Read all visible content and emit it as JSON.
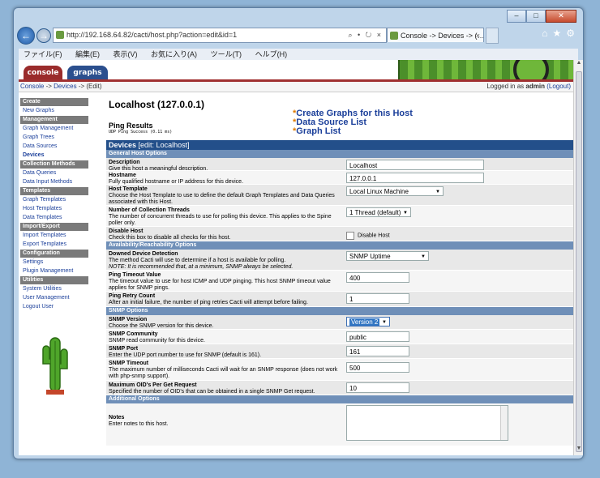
{
  "browser": {
    "address_url": "http://192.168.64.82/cacti/host.php?action=edit&id=1",
    "address_tools": "⌕ • ↻ ×",
    "tab_title": "Console -> Devices -> (…",
    "tab_close": "×",
    "caption": {
      "minimize": "–",
      "maximize": "□",
      "close": "✕"
    },
    "back": "←",
    "forward": "→",
    "right_icons": "⌂★⚙",
    "menu": [
      "ファイル(F)",
      "編集(E)",
      "表示(V)",
      "お気に入り(A)",
      "ツール(T)",
      "ヘルプ(H)"
    ]
  },
  "cacti": {
    "tabs": {
      "console": "console",
      "graphs": "graphs"
    },
    "breadcrumb": {
      "console": "Console",
      "sep": " -> ",
      "devices": "Devices",
      "sep2": " -> ",
      "current": "(Edit)"
    },
    "login": {
      "prefix": "Logged in as ",
      "user": "admin",
      "logout": "(Logout)"
    }
  },
  "sidebar": {
    "groups": [
      {
        "header": "Create",
        "items": [
          "New Graphs"
        ]
      },
      {
        "header": "Management",
        "items": [
          "Graph Management",
          "Graph Trees",
          "Data Sources",
          "Devices"
        ]
      },
      {
        "header": "Collection Methods",
        "items": [
          "Data Queries",
          "Data Input Methods"
        ]
      },
      {
        "header": "Templates",
        "items": [
          "Graph Templates",
          "Host Templates",
          "Data Templates"
        ]
      },
      {
        "header": "Import/Export",
        "items": [
          "Import Templates",
          "Export Templates"
        ]
      },
      {
        "header": "Configuration",
        "items": [
          "Settings",
          "Plugin Management"
        ]
      },
      {
        "header": "Utilities",
        "items": [
          "System Utilities",
          "User Management",
          "Logout User"
        ]
      }
    ],
    "active": "Devices"
  },
  "host": {
    "title": "Localhost (127.0.0.1)",
    "ping_title": "Ping Results",
    "ping_status": "UDP Ping Success (0.11 ms)",
    "links": [
      "Create Graphs for this Host",
      "Data Source List",
      "Graph List"
    ],
    "link_star": "*"
  },
  "form": {
    "header": "Devices",
    "header_edit": "[edit: Localhost]",
    "sections": {
      "general": "General Host Options",
      "availability": "Availability/Reachability Options",
      "snmp": "SNMP Options",
      "additional": "Additional Options"
    },
    "fields": {
      "description": {
        "label": "Description",
        "help": "Give this host a meaningful description.",
        "value": "Localhost"
      },
      "hostname": {
        "label": "Hostname",
        "help": "Fully qualified hostname or IP address for this device.",
        "value": "127.0.0.1"
      },
      "host_template": {
        "label": "Host Template",
        "help": "Choose the Host Template to use to define the default Graph Templates and Data Queries associated with this Host.",
        "value": "Local Linux Machine"
      },
      "threads": {
        "label": "Number of Collection Threads",
        "help": "The number of concurrent threads to use for polling this device. This applies to the Spine poller only.",
        "value": "1 Thread (default)"
      },
      "disable": {
        "label": "Disable Host",
        "help": "Check this box to disable all checks for this host.",
        "checkbox_label": "Disable Host"
      },
      "downed": {
        "label": "Downed Device Detection",
        "help": "The method Cacti will use to determine if a host is available for polling.",
        "note": "NOTE: It is recommended that, at a minimum, SNMP always be selected.",
        "value": "SNMP Uptime"
      },
      "ping_timeout": {
        "label": "Ping Timeout Value",
        "help": "The timeout value to use for host ICMP and UDP pinging. This host SNMP timeout value applies for SNMP pings.",
        "value": "400"
      },
      "ping_retry": {
        "label": "Ping Retry Count",
        "help": "After an initial failure, the number of ping retries Cacti will attempt before failing.",
        "value": "1"
      },
      "snmp_version": {
        "label": "SNMP Version",
        "help": "Choose the SNMP version for this device.",
        "value": "Version 2"
      },
      "snmp_community": {
        "label": "SNMP Community",
        "help": "SNMP read community for this device.",
        "value": "public"
      },
      "snmp_port": {
        "label": "SNMP Port",
        "help": "Enter the UDP port number to use for SNMP (default is 161).",
        "value": "161"
      },
      "snmp_timeout": {
        "label": "SNMP Timeout",
        "help": "The maximum number of milliseconds Cacti will wait for an SNMP response (does not work with php-snmp support).",
        "value": "500"
      },
      "max_oids": {
        "label": "Maximum OID's Per Get Request",
        "help": "Specified the number of OID's that can be obtained in a single SNMP Get request.",
        "value": "10"
      },
      "notes": {
        "label": "Notes",
        "help": "Enter notes to this host.",
        "value": ""
      }
    }
  },
  "colors": {
    "console_tab": "#9a2b2b",
    "graphs_tab": "#2b4f8e",
    "form_header": "#234f8a",
    "section_header": "#6f8fb8",
    "link": "#1b3f9a"
  }
}
